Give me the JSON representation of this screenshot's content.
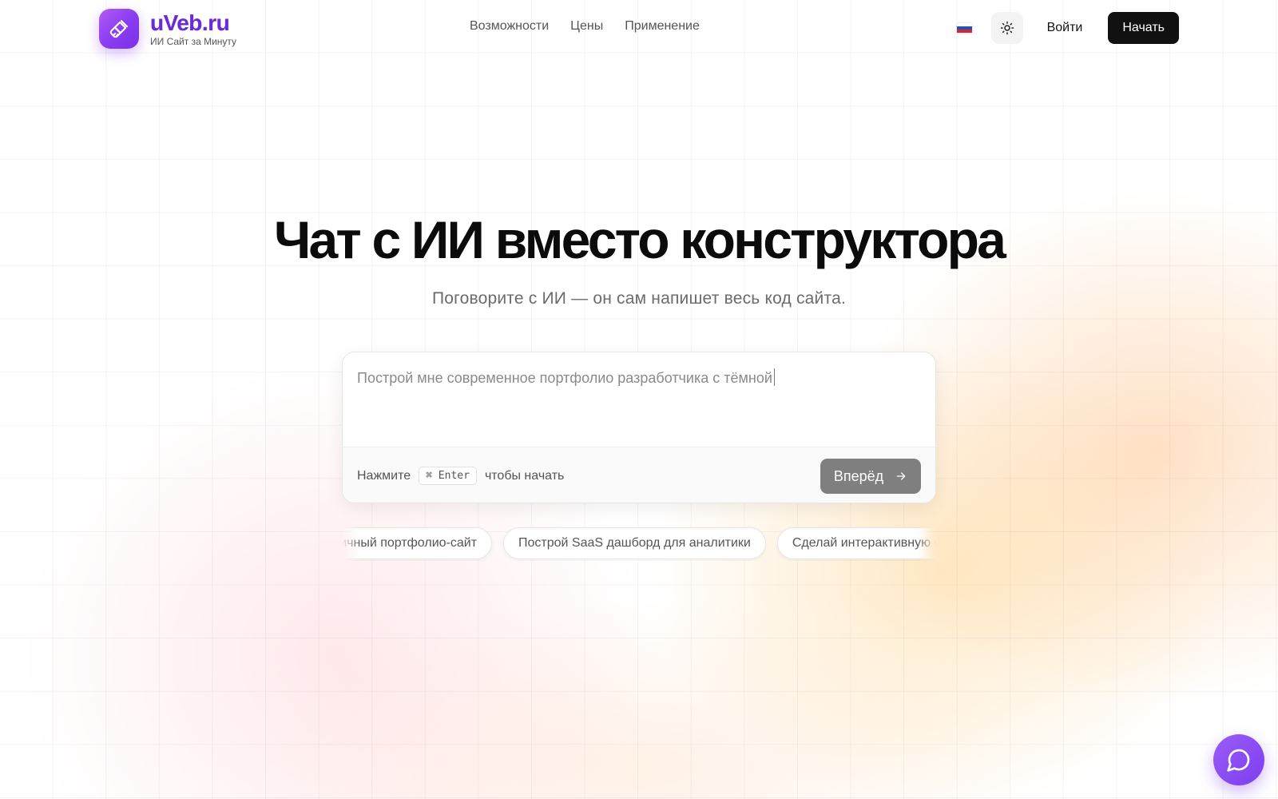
{
  "brand": {
    "name": "uVeb.ru",
    "tagline": "ИИ Сайт за Минуту",
    "accent": "#8b3df0"
  },
  "nav": {
    "items": [
      "Возможности",
      "Цены",
      "Применение"
    ]
  },
  "header": {
    "language_flag": "flag-ru-icon",
    "theme_toggle_icon": "sun-icon",
    "login_label": "Войти",
    "start_label": "Начать"
  },
  "hero": {
    "title": "Чат с ИИ вместо конструктора",
    "subtitle": "Поговорите с ИИ — он сам напишет весь код сайта."
  },
  "prompt": {
    "text": "Построй мне современное портфолио разработчика с тёмной",
    "hint_before": "Нажмите",
    "shortcut": "⌘ Enter",
    "hint_after": "чтобы начать",
    "submit_label": "Вперёд",
    "submit_icon": "arrow-right-icon"
  },
  "suggestions": [
    "Создай личный портфолио-сайт",
    "Построй SaaS дашборд для аналитики",
    "Сделай интерактивную страницу"
  ],
  "chat_widget": {
    "icon": "chat-bubble-icon",
    "color": "#8b48f3"
  }
}
